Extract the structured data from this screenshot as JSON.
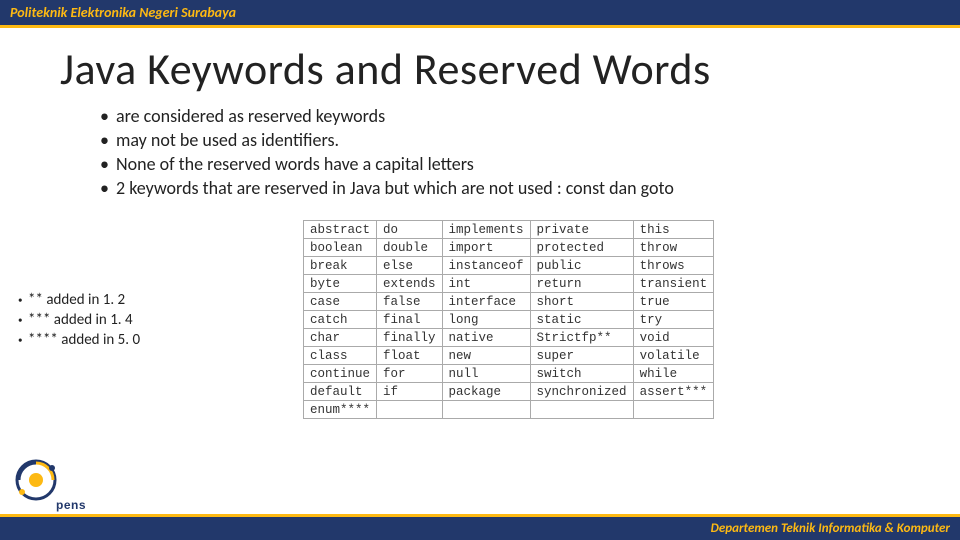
{
  "header": {
    "org": "Politeknik Elektronika Negeri Surabaya"
  },
  "title": "Java Keywords and Reserved Words",
  "bullets": [
    "are considered as reserved keywords",
    "may not be used as identifiers.",
    "None of the reserved words have a capital letters",
    "2 keywords that are reserved in Java but which are not used : const dan goto"
  ],
  "notes": [
    "**   added in 1. 2",
    "***   added in 1. 4",
    "****   added in 5. 0"
  ],
  "keywords": [
    [
      "abstract",
      "do",
      "implements",
      "private",
      "this"
    ],
    [
      "boolean",
      "double",
      "import",
      "protected",
      "throw"
    ],
    [
      "break",
      "else",
      "instanceof",
      "public",
      "throws"
    ],
    [
      "byte",
      "extends",
      "int",
      "return",
      "transient"
    ],
    [
      "case",
      "false",
      "interface",
      "short",
      "true"
    ],
    [
      "catch",
      "final",
      "long",
      "static",
      "try"
    ],
    [
      "char",
      "finally",
      "native",
      "Strictfp**",
      "void"
    ],
    [
      "class",
      "float",
      "new",
      "super",
      "volatile"
    ],
    [
      "continue",
      "for",
      "null",
      "switch",
      "while"
    ],
    [
      "default",
      "if",
      "package",
      "synchronized",
      "assert***"
    ],
    [
      "enum****",
      "",
      "",
      "",
      ""
    ]
  ],
  "footer": {
    "dept": "Departemen Teknik Informatika & Komputer"
  },
  "logo": {
    "text": "pens"
  }
}
